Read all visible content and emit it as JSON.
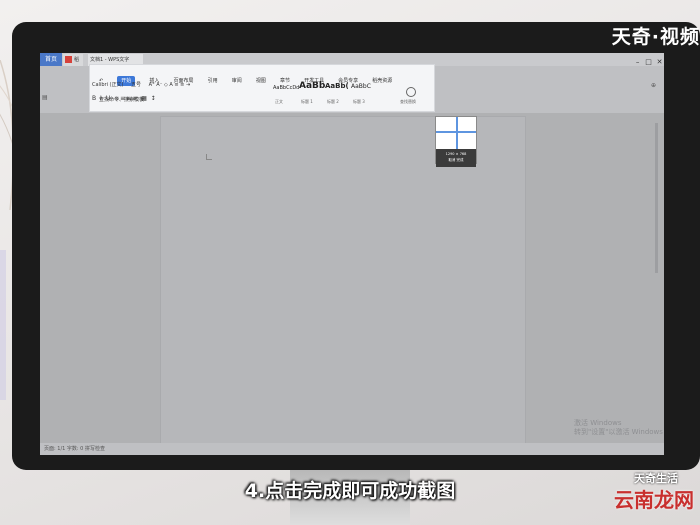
{
  "watermark_top": "天奇·视频",
  "titlebar": {
    "home_tab": "首页",
    "shell_tab": "稻壳",
    "doc_tab": "文档1 - WPS文字"
  },
  "ribbon": {
    "menus": [
      "开始",
      "插入",
      "页面布局",
      "引用",
      "审阅",
      "视图",
      "章节",
      "开发工具",
      "会员专享",
      "稻壳资源"
    ],
    "active_menu": "开始",
    "search_placeholder": "查找命令、搜索模板",
    "font_name": "Calibri (正文)",
    "font_size": "五号",
    "styles": [
      {
        "sample": "AaBbCcDd",
        "label": "正文"
      },
      {
        "sample": "AaBb",
        "label": "标题 1"
      },
      {
        "sample": "AaBb(",
        "label": "标题 2"
      },
      {
        "sample": "AaBbC",
        "label": "标题 3"
      }
    ],
    "find_label": "查找替换"
  },
  "screenshot_box": {
    "caption_line1": "1290 × 768",
    "caption_line2": "取消 完成"
  },
  "statusbar": {
    "page_info": "页面: 1/1  字数: 0  拼写检查"
  },
  "activate_text": {
    "line1": "激活 Windows",
    "line2": "转到\"设置\"以激活 Windows"
  },
  "subtitle": "4.点击完成即可成功截图",
  "brand_top": "天奇生活",
  "brand_bottom": "云南龙网"
}
